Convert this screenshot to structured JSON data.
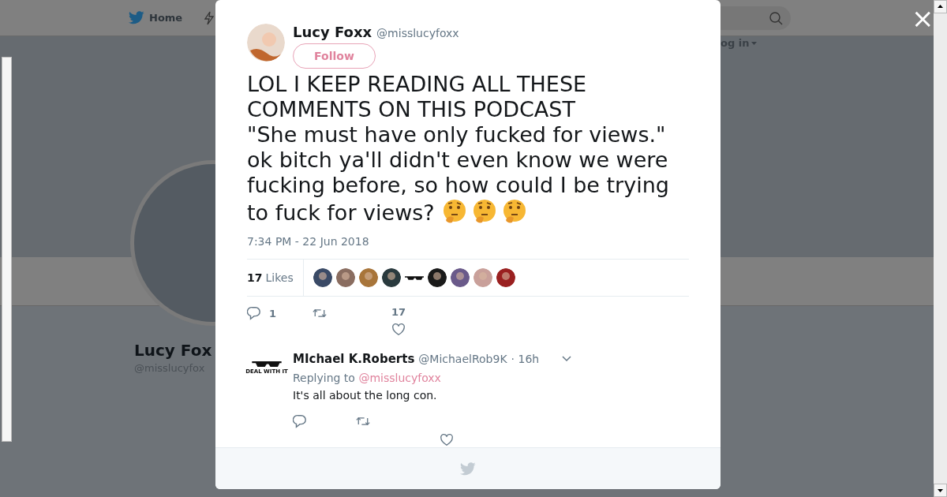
{
  "background_page": {
    "nav": {
      "home_label": "Home",
      "login_label": "og in"
    },
    "profile": {
      "name": "Lucy Fox",
      "handle": "@misslucyfox"
    }
  },
  "close_label": "×",
  "tweet": {
    "author": {
      "name": "Lucy Foxx",
      "handle": "@misslucyfoxx"
    },
    "follow_label": "Follow",
    "text": "LOL I KEEP READING ALL THESE COMMENTS ON THIS PODCAST\n\"She must have only fucked for views.\"\nok bitch ya'll didn't even know we were fucking before, so how could I be trying to fuck for views?",
    "emojis": [
      {
        "kind": "thinking"
      },
      {
        "kind": "thinking"
      },
      {
        "kind": "thinking"
      }
    ],
    "time": "7:34 PM - 22 Jun 2018",
    "likes_count": "17",
    "likes_label": "Likes",
    "likers": [
      {
        "kind": "photo"
      },
      {
        "kind": "photo"
      },
      {
        "kind": "photo"
      },
      {
        "kind": "photo"
      },
      {
        "kind": "sunglasses"
      },
      {
        "kind": "photo"
      },
      {
        "kind": "photo"
      },
      {
        "kind": "photo"
      },
      {
        "kind": "photo"
      }
    ],
    "reply_count": "1",
    "like_count": "17"
  },
  "reply": {
    "name": "MIchael K.Roberts",
    "handle": "@MichaelRob9K",
    "age": "· 16h",
    "avatar_caption": "DEAL WITH IT",
    "replying_label": "Replying to",
    "replying_handle": "@misslucyfoxx",
    "text": "It's all about the long con."
  }
}
